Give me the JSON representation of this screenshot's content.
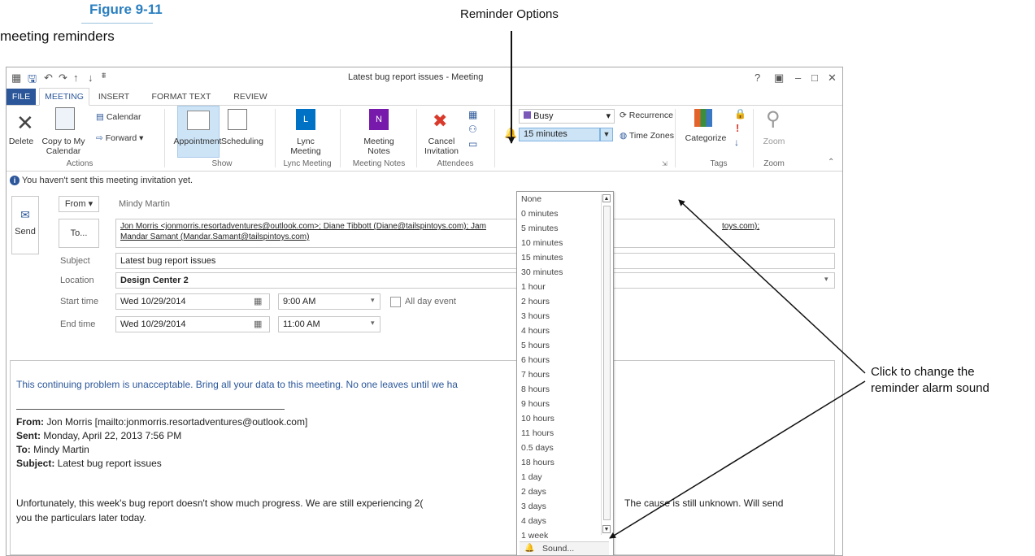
{
  "figure": {
    "label": "Figure 9-11",
    "caption": "meeting reminders"
  },
  "callouts": {
    "reminder_options": "Reminder Options",
    "sound_line1": "Click to change the",
    "sound_line2": "reminder alarm sound"
  },
  "window": {
    "title": "Latest bug report issues - Meeting",
    "help": "?"
  },
  "tabs": [
    "FILE",
    "MEETING",
    "INSERT",
    "FORMAT TEXT",
    "REVIEW"
  ],
  "ribbon": {
    "delete": "Delete",
    "copy1": "Copy to My",
    "copy2": "Calendar",
    "calendar": "Calendar",
    "forward": "Forward",
    "actions": "Actions",
    "appointment": "Appointment",
    "scheduling": "Scheduling",
    "show": "Show",
    "lync1": "Lync",
    "lync2": "Meeting",
    "lync_group": "Lync Meeting",
    "notes1": "Meeting",
    "notes2": "Notes",
    "notes_group": "Meeting Notes",
    "cancel1": "Cancel",
    "cancel2": "Invitation",
    "attendees": "Attendees",
    "busy": "Busy",
    "recurrence": "Recurrence",
    "reminder": "15 minutes",
    "timezones": "Time Zones",
    "categorize": "Categorize",
    "tags": "Tags",
    "zoom": "Zoom",
    "zoom_group": "Zoom"
  },
  "info": "You haven't sent this meeting invitation yet.",
  "form": {
    "send": "Send",
    "from_btn": "From",
    "from_val": "Mindy Martin",
    "to_btn": "To...",
    "to_line1a": "Jon Morris <jonmorris.resortadventures@outlook.com>; Diane Tibbott (Diane@tailspintoys.com); Jam",
    "to_line1b": "toys.com);",
    "to_line2": "Mandar Samant (Mandar.Samant@tailspintoys.com)",
    "subject_lbl": "Subject",
    "subject_val": "Latest bug report issues",
    "location_lbl": "Location",
    "location_val": "Design Center 2",
    "start_lbl": "Start time",
    "start_date": "Wed 10/29/2014",
    "start_time": "9:00 AM",
    "allday": "All day event",
    "end_lbl": "End time",
    "end_date": "Wed 10/29/2014",
    "end_time": "11:00 AM"
  },
  "body": {
    "line1": "This continuing problem is unacceptable. Bring all your data to this meeting. No one leaves until we ha",
    "from_b": "From:",
    "from_t": " Jon Morris [mailto:jonmorris.resortadventures@outlook.com]",
    "sent_b": "Sent:",
    "sent_t": " Monday, April 22, 2013 7:56 PM",
    "to_b": "To:",
    "to_t": " Mindy Martin",
    "subj_b": "Subject:",
    "subj_t": " Latest bug report issues",
    "p1a": "Unfortunately, this week's bug report doesn't show much progress. We are still experiencing 2(",
    "p1b": "The cause is still unknown. Will send",
    "p2": "you the particulars later today."
  },
  "dropdown": [
    "None",
    "0 minutes",
    "5 minutes",
    "10 minutes",
    "15 minutes",
    "30 minutes",
    "1 hour",
    "2 hours",
    "3 hours",
    "4 hours",
    "5 hours",
    "6 hours",
    "7 hours",
    "8 hours",
    "9 hours",
    "10 hours",
    "11 hours",
    "0.5 days",
    "18 hours",
    "1 day",
    "2 days",
    "3 days",
    "4 days",
    "1 week"
  ],
  "sound": "Sound..."
}
